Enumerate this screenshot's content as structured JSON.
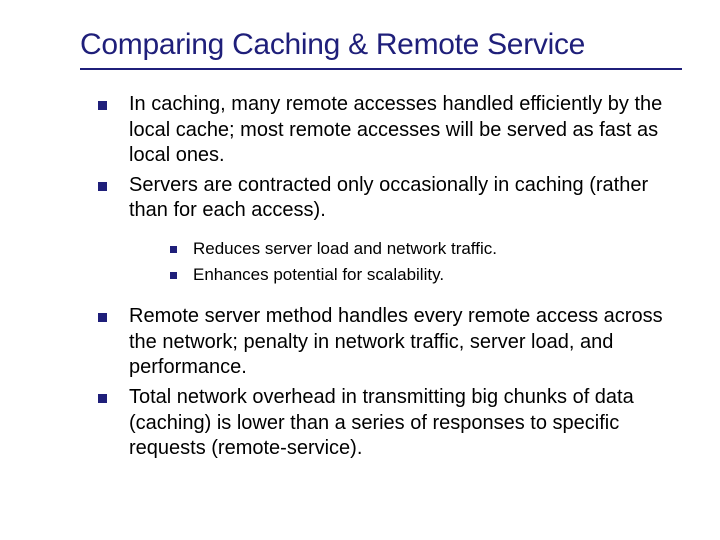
{
  "title": "Comparing Caching & Remote Service",
  "bullets": {
    "b1": "In caching, many remote accesses handled efficiently by the local cache; most remote accesses will be served as fast as local ones.",
    "b2": "Servers are contracted only occasionally in caching (rather than for each access).",
    "b2a": "Reduces server load and network traffic.",
    "b2b": "Enhances potential for scalability.",
    "b3": "Remote server method handles every remote access across the network; penalty in network traffic, server load, and performance.",
    "b4": "Total network overhead in transmitting big chunks of data (caching) is lower than a series of responses to specific requests (remote-service)."
  }
}
